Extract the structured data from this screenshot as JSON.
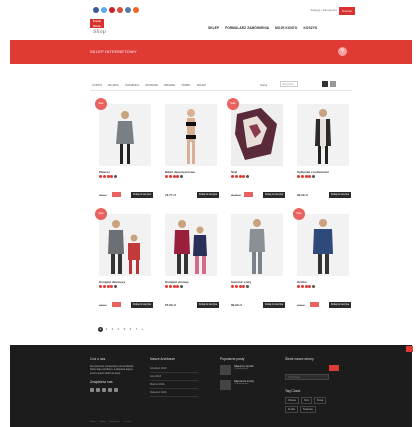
{
  "topbar": {
    "account_text": "Zaloguj / Zarejestruj",
    "cart_label": "Koszyk",
    "social_icons": [
      "facebook-icon",
      "twitter-icon",
      "pinterest-icon",
      "googleplus-icon",
      "instagram-icon",
      "rss-icon"
    ]
  },
  "logo": {
    "box_text": "Fresh Store",
    "script_text": "Shop"
  },
  "nav": {
    "items": [
      "SKLEP",
      "FORMULARZ ZAMÓWIENIA",
      "MOJE KONTO",
      "KOSZYK"
    ]
  },
  "band": {
    "title": "SKLEP INTERNETOWY"
  },
  "categories": {
    "items": [
      "KURTKI",
      "BLUZKA",
      "SUKIENKA",
      "SPODNIE",
      "OBUWIE",
      "TORBY",
      "SKLEP"
    ],
    "sort_label": "Sortuj",
    "sort_value": "domyślnie"
  },
  "products": [
    {
      "name": "Płaszcz",
      "old": "299 zł",
      "price": "",
      "sale": true,
      "rating": 4,
      "cart": "Dodaj do koszyka",
      "badge": "Sale"
    },
    {
      "name": "Bikini dwuczęściowe",
      "old": "",
      "price": "79.77 zł",
      "sale": false,
      "rating": 4,
      "cart": "Dodaj do koszyka",
      "badge": ""
    },
    {
      "name": "Szal",
      "old": "99.99 zł",
      "price": "",
      "sale": true,
      "rating": 4,
      "cart": "Dodaj do koszyka",
      "badge": "Sale"
    },
    {
      "name": "Sukienka z kołnierzem",
      "old": "",
      "price": "99.39 zł",
      "sale": false,
      "rating": 4,
      "cart": "Dodaj do koszyka",
      "badge": ""
    },
    {
      "name": "Komplet dziecięcy",
      "old": "199 zł",
      "price": "",
      "sale": true,
      "rating": 4,
      "cart": "Dodaj do koszyka",
      "badge": "Sale"
    },
    {
      "name": "Komplet zimowy",
      "old": "",
      "price": "67.99 zł",
      "sale": false,
      "rating": 4,
      "cart": "Dodaj do koszyka",
      "badge": ""
    },
    {
      "name": "Garnitur szary",
      "old": "",
      "price": "89.99 zł",
      "sale": false,
      "rating": 4,
      "cart": "Dodaj do koszyka",
      "badge": ""
    },
    {
      "name": "Kurtka",
      "old": "199 zł",
      "price": "",
      "sale": true,
      "rating": 4,
      "cart": "Dodaj do koszyka",
      "badge": "Sale"
    }
  ],
  "pager": {
    "pages": [
      "1",
      "2",
      "3",
      "4",
      "5",
      "6",
      "7",
      "»"
    ],
    "current": "1"
  },
  "footer": {
    "about_title": "Coś o nas",
    "about_text": "Sed posuere consectetur est at lobortis. Nulla vitae elit libero, a pharetra augue. Lorem ipsum dolor sit amet.",
    "follow_title": "Znajdziesz nas",
    "archive_title": "Nasze Archiwum",
    "archive_items": [
      "Grudzień 2013",
      "Luty 2013",
      "Marzec 2013",
      "Kwiecień 2013"
    ],
    "popular_title": "Popularne posty",
    "posts": [
      {
        "title": "Najlepszy sposób",
        "meta": "10 komentarzy"
      },
      {
        "title": "Najnowsze trendy",
        "meta": "10 komentarzy"
      }
    ],
    "newsletter_title": "Śledź nasze strony",
    "newsletter_placeholder": "Twój Email",
    "tags_title": "Tag Cloud",
    "tags": [
      "Obuwie",
      "Dom",
      "Moda",
      "Kurtka",
      "Sukienka"
    ],
    "bottom_links": [
      "Home",
      "Sklep",
      "Regulamin",
      "Kontakt"
    ]
  },
  "colors": {
    "accent": "#e03a35",
    "footer_bg": "#1c1c1c",
    "sale_badge": "#e8635f"
  }
}
